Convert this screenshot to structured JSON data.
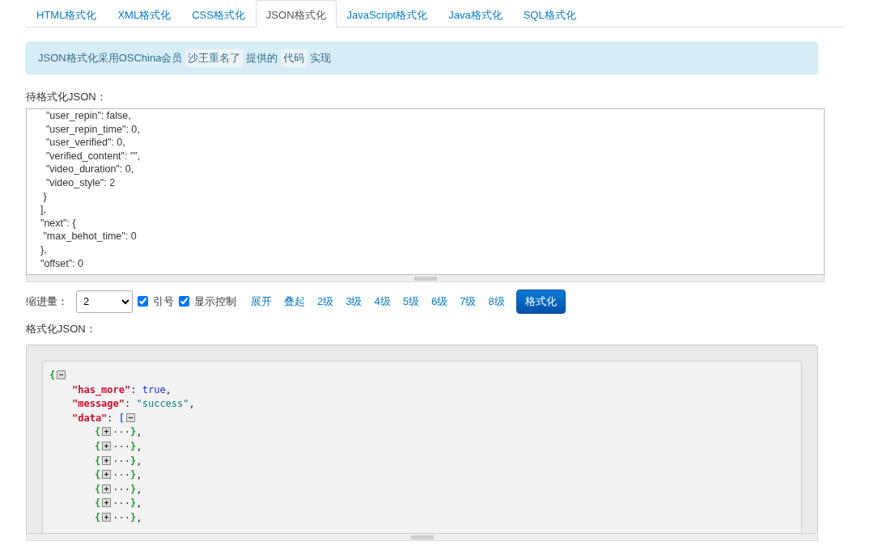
{
  "tabs": [
    {
      "label": "HTML格式化",
      "selected": false
    },
    {
      "label": "XML格式化",
      "selected": false
    },
    {
      "label": "CSS格式化",
      "selected": false
    },
    {
      "label": "JSON格式化",
      "selected": true
    },
    {
      "label": "JavaScript格式化",
      "selected": false
    },
    {
      "label": "Java格式化",
      "selected": false
    },
    {
      "label": "SQL格式化",
      "selected": false
    }
  ],
  "notice": {
    "parts": [
      {
        "kind": "text",
        "text": "JSON格式化采用OSChina会员"
      },
      {
        "kind": "tag",
        "text": "沙王重名了"
      },
      {
        "kind": "text",
        "text": "提供的"
      },
      {
        "kind": "tag",
        "text": "代码"
      },
      {
        "kind": "text",
        "text": "实现"
      }
    ]
  },
  "input": {
    "label": "待格式化JSON：",
    "lines": [
      "    \"user_repin\": false,",
      "    \"user_repin_time\": 0,",
      "    \"user_verified\": 0,",
      "    \"verified_content\": \"\",",
      "    \"video_duration\": 0,",
      "    \"video_style\": 2",
      "   }",
      "  ],",
      "  \"next\": {",
      "   \"max_behot_time\": 0",
      "  },",
      "  \"offset\": 0"
    ]
  },
  "controls": {
    "indent_label": "缩进量：",
    "indent_value": "2",
    "checks": [
      {
        "label": "引号",
        "checked": true
      },
      {
        "label": "显示控制",
        "checked": true
      }
    ],
    "links": [
      "展开",
      "叠起",
      "2级",
      "3级",
      "4级",
      "5级",
      "6级",
      "7级",
      "8级"
    ],
    "button": "格式化"
  },
  "output": {
    "label": "格式化JSON：",
    "tree": [
      {
        "tokens": [
          {
            "kind": "brace",
            "text": "{"
          },
          {
            "kind": "toggle",
            "expanded": true
          }
        ],
        "children": [
          {
            "tokens": [
              {
                "kind": "key",
                "text": "\"has_more\""
              },
              {
                "kind": "punct",
                "text": ": "
              },
              {
                "kind": "bool",
                "text": "true"
              },
              {
                "kind": "punct",
                "text": ","
              }
            ]
          },
          {
            "tokens": [
              {
                "kind": "key",
                "text": "\"message\""
              },
              {
                "kind": "punct",
                "text": ": "
              },
              {
                "kind": "string",
                "text": "\"success\""
              },
              {
                "kind": "punct",
                "text": ","
              }
            ]
          },
          {
            "tokens": [
              {
                "kind": "key",
                "text": "\"data\""
              },
              {
                "kind": "punct",
                "text": ": "
              },
              {
                "kind": "bracket",
                "text": "["
              },
              {
                "kind": "toggle",
                "expanded": true
              }
            ],
            "children": [
              {
                "tokens": [
                  {
                    "kind": "brace",
                    "text": "{"
                  },
                  {
                    "kind": "toggle",
                    "expanded": false
                  },
                  {
                    "kind": "ellipsis",
                    "text": "···"
                  },
                  {
                    "kind": "brace",
                    "text": "}"
                  },
                  {
                    "kind": "punct",
                    "text": ","
                  }
                ]
              },
              {
                "tokens": [
                  {
                    "kind": "brace",
                    "text": "{"
                  },
                  {
                    "kind": "toggle",
                    "expanded": false
                  },
                  {
                    "kind": "ellipsis",
                    "text": "···"
                  },
                  {
                    "kind": "brace",
                    "text": "}"
                  },
                  {
                    "kind": "punct",
                    "text": ","
                  }
                ]
              },
              {
                "tokens": [
                  {
                    "kind": "brace",
                    "text": "{"
                  },
                  {
                    "kind": "toggle",
                    "expanded": false
                  },
                  {
                    "kind": "ellipsis",
                    "text": "···"
                  },
                  {
                    "kind": "brace",
                    "text": "}"
                  },
                  {
                    "kind": "punct",
                    "text": ","
                  }
                ]
              },
              {
                "tokens": [
                  {
                    "kind": "brace",
                    "text": "{"
                  },
                  {
                    "kind": "toggle",
                    "expanded": false
                  },
                  {
                    "kind": "ellipsis",
                    "text": "···"
                  },
                  {
                    "kind": "brace",
                    "text": "}"
                  },
                  {
                    "kind": "punct",
                    "text": ","
                  }
                ]
              },
              {
                "tokens": [
                  {
                    "kind": "brace",
                    "text": "{"
                  },
                  {
                    "kind": "toggle",
                    "expanded": false
                  },
                  {
                    "kind": "ellipsis",
                    "text": "···"
                  },
                  {
                    "kind": "brace",
                    "text": "}"
                  },
                  {
                    "kind": "punct",
                    "text": ","
                  }
                ]
              },
              {
                "tokens": [
                  {
                    "kind": "brace",
                    "text": "{"
                  },
                  {
                    "kind": "toggle",
                    "expanded": false
                  },
                  {
                    "kind": "ellipsis",
                    "text": "···"
                  },
                  {
                    "kind": "brace",
                    "text": "}"
                  },
                  {
                    "kind": "punct",
                    "text": ","
                  }
                ]
              },
              {
                "tokens": [
                  {
                    "kind": "brace",
                    "text": "{"
                  },
                  {
                    "kind": "toggle",
                    "expanded": false
                  },
                  {
                    "kind": "ellipsis",
                    "text": "···"
                  },
                  {
                    "kind": "brace",
                    "text": "}"
                  },
                  {
                    "kind": "punct",
                    "text": ","
                  }
                ]
              }
            ]
          }
        ]
      }
    ]
  }
}
